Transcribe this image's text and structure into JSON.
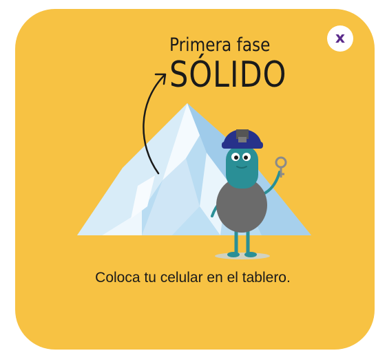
{
  "dialog": {
    "close_label": "x",
    "subtitle": "Primera fase",
    "title": "SÓLIDO",
    "instruction": "Coloca tu celular en el tablero."
  },
  "colors": {
    "card_background": "#f7c243",
    "close_icon": "#5a2a8a",
    "ice_light": "#e7f3fb",
    "ice_mid": "#a9d1ee",
    "character_head": "#2a8f96",
    "character_body": "#6b6b6b",
    "helmet": "#27328a"
  }
}
